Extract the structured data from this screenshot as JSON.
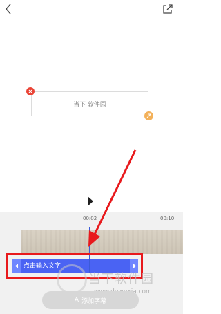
{
  "canvas": {
    "text_box_text": "当下 软件园"
  },
  "timeline": {
    "time_start": "00:02",
    "time_end": "00:10",
    "subtitle_placeholder": "点击输入文字"
  },
  "bottom": {
    "add_subtitle_label": "添加字幕",
    "add_subtitle_icon": "A"
  },
  "watermark": {
    "title": "当下软件园",
    "url": "www.downxia.com"
  },
  "colors": {
    "accent": "#4a63f3",
    "annotation": "#e8191c",
    "delete": "#ea4335",
    "resize": "#f3b15a"
  }
}
